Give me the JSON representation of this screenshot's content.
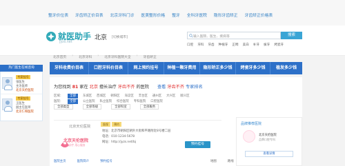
{
  "top_links": [
    "整牙价位表",
    "牙齿矫正价目表",
    "北京牙科门诊",
    "医美整形价格",
    "整牙",
    "全科牙医院",
    "隐形牙齿矫正",
    "牙齿矫正价格表"
  ],
  "header": {
    "logo_title": "就医助手",
    "logo_url": "jyzs.net",
    "city": "北京",
    "city_switch": "[切换城市]",
    "search_placeholder": "输入医院、医生、疾病等",
    "search_button": "搜索",
    "hot_words": [
      "口腔",
      "牙科",
      "牙齿",
      "种植牙",
      "正畸",
      "美白",
      "补牙",
      "拔牙",
      "烤瓷牙"
    ]
  },
  "breadcrumb": [
    "北京首页",
    "北京牙科",
    "北京牙科医院大全",
    "牙齿矫正"
  ],
  "nav": [
    "牙科收费价目表",
    "口腔牙科价目表",
    "网上预约挂号",
    "种植一颗牙费用",
    "隐形矫正多少钱",
    "烤瓷牙多少钱",
    "植发多少钱"
  ],
  "floating": {
    "title": "热门医生在线咨询",
    "doctors": [
      {
        "badge": "专家挂号",
        "name": "张医生",
        "title": "主治医师",
        "hospital": "北京天伦医院"
      },
      {
        "badge": "专家挂号",
        "name": "王医生",
        "title": "副主任医师",
        "hospital": "北京仁和医院"
      }
    ]
  },
  "results": {
    "prefix": "为您找到",
    "count": "81",
    "middle1": "家在",
    "city": "北京",
    "middle2": "擅长治疗",
    "keyword": "牙齿不齐",
    "middle3": "的医院",
    "sub1": "查看",
    "sub_keyword": "牙齿不齐",
    "sub2": "专家排名"
  },
  "filters": {
    "row1": [
      "区域：",
      "全部",
      "东城区",
      "西城区",
      "朝阳区",
      "海淀区",
      "丰台区",
      "通州区",
      "大兴区",
      "顺义区"
    ],
    "row2": [
      "医院：",
      "全部",
      "公立医院",
      "私立医院",
      "综合医院",
      "专科医院",
      "口腔医院"
    ],
    "row3": [
      "排序：",
      "综合排序",
      "热度",
      "评分",
      "价格",
      "距离"
    ],
    "selects": [
      "全部类型",
      "全部等级",
      "全部科室",
      "全部服务"
    ]
  },
  "hospital": {
    "name": "北京天伦医院",
    "tags": [
      "医保",
      "预约"
    ],
    "logo_title": "北京天伦医院",
    "logo_slogan": "专业诊疗 用心服务",
    "address": "地址：北京市朝阳区朝外大街和平路附近8号楼二层",
    "phone": "电话：010-1234-5678",
    "website": "网址：http://jyzs.net/bj",
    "book": "预约挂号",
    "bottom_links": [
      "医院主页",
      "医院简介",
      "预约挂号"
    ],
    "bottom_right": [
      "地图",
      "路线",
      "评价"
    ]
  },
  "sidebar": {
    "title": "品牌推荐医院",
    "hospital_name": "北京天伦医院",
    "subtitle": "品牌口腔专科",
    "button": "查看详情"
  }
}
